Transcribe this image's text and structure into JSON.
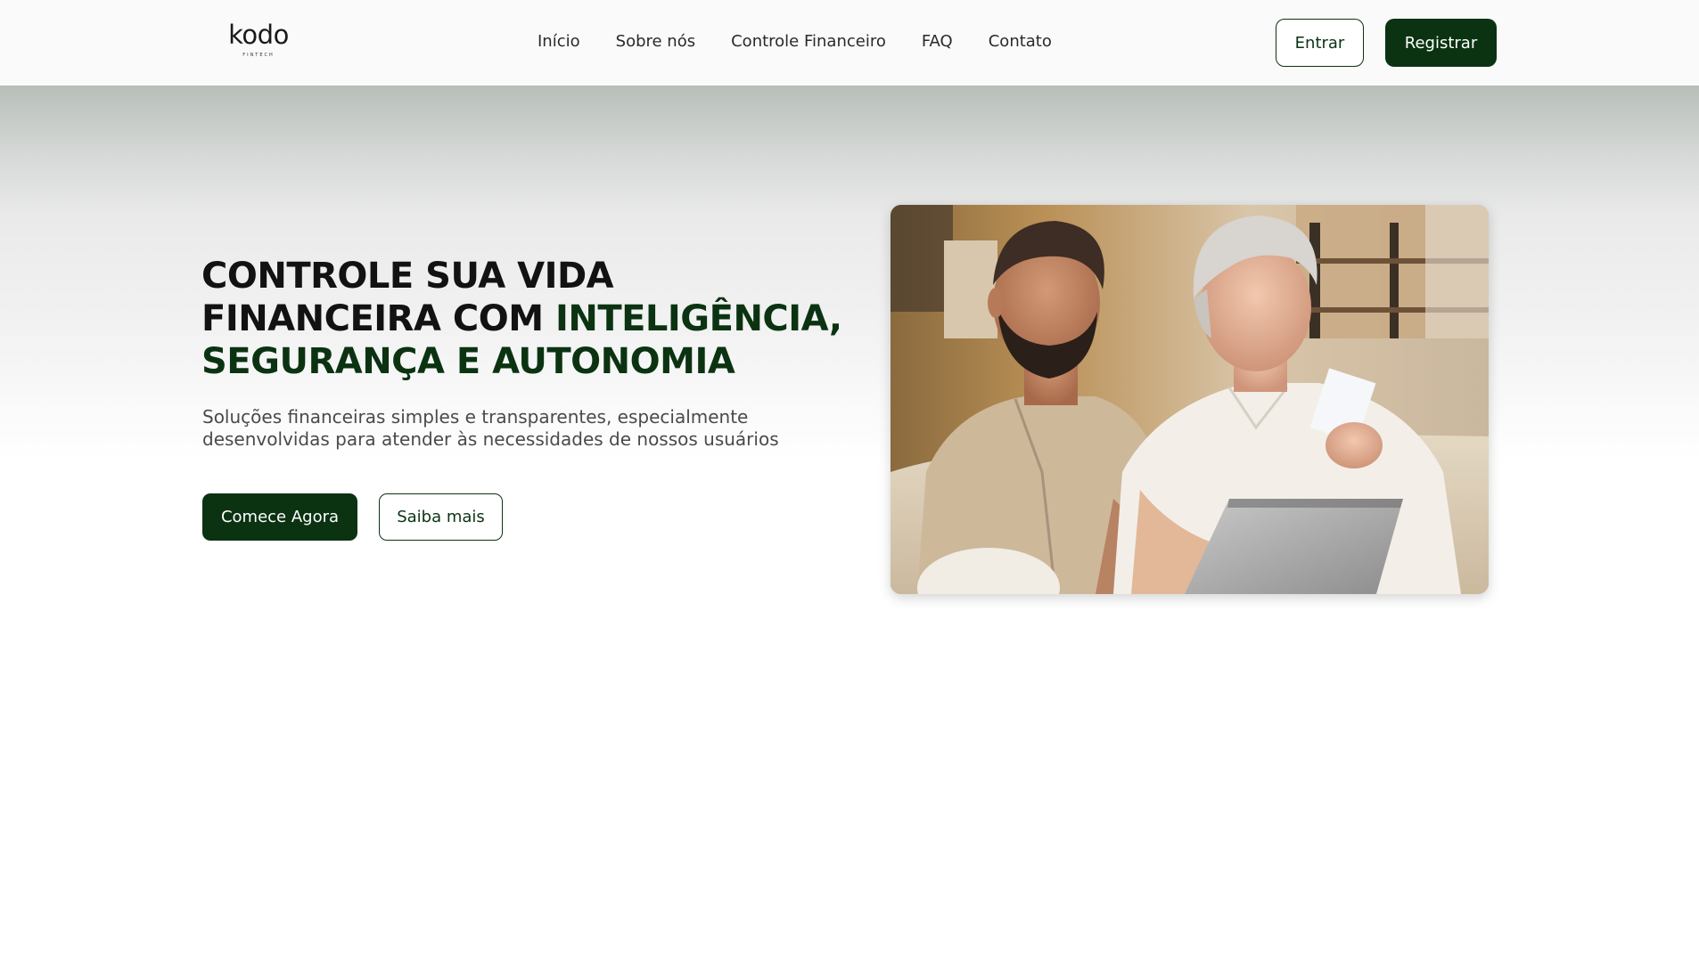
{
  "logo": {
    "name": "kodo",
    "tagline": "FINTECH"
  },
  "nav": {
    "links": [
      "Início",
      "Sobre nós",
      "Controle Financeiro",
      "FAQ",
      "Contato"
    ],
    "login_label": "Entrar",
    "register_label": "Registrar"
  },
  "hero": {
    "headline_line1": "CONTROLE SUA VIDA",
    "headline_line2_plain": "FINANCEIRA COM ",
    "headline_line2_accent": "INTELIGÊNCIA,",
    "headline_line3_accent": "SEGURANÇA E AUTONOMIA",
    "subtitle_line1": "Soluções financeiras simples e transparentes, especialmente",
    "subtitle_line2": "desenvolvidas para atender às necessidades de nossos usuários",
    "primary_cta": "Comece Agora",
    "secondary_cta": "Saiba mais",
    "image_icon": "photo-two-people-laptop"
  },
  "colors": {
    "brand": "#0b3312",
    "text": "#121212",
    "muted": "#4a4a4a"
  }
}
